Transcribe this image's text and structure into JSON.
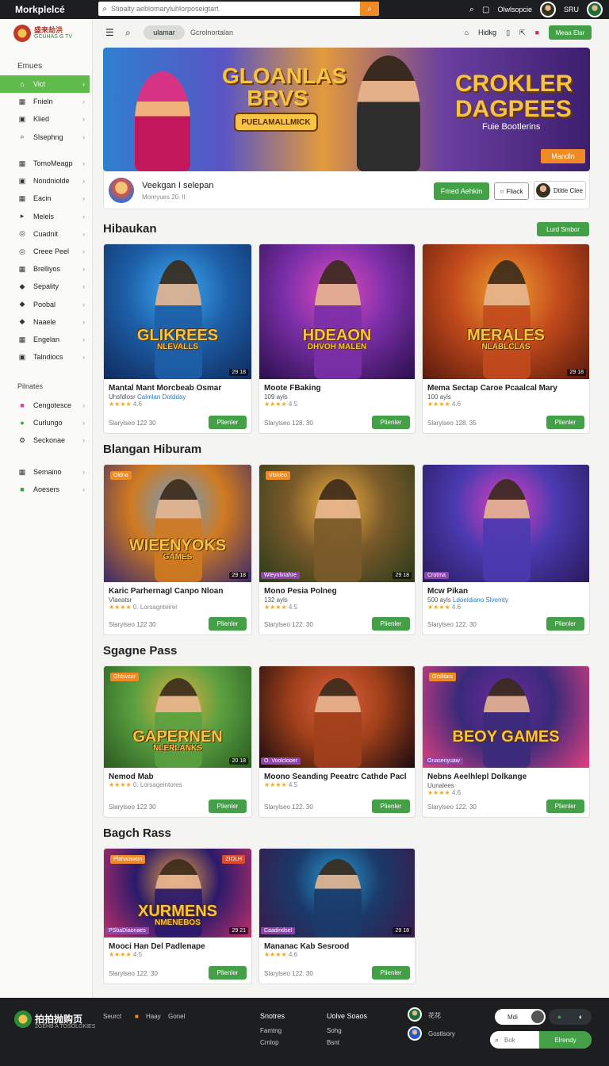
{
  "topbar": {
    "brand": "Morkplelcé",
    "search_placeholder": "Stioalty aeblomaryluhlorposeigtart",
    "search_icon": "search-icon",
    "go_icon": "search-go-icon",
    "right_label": "Olwlsopcie",
    "user_label": "SRU"
  },
  "sidebar": {
    "logo_line1": "盛来劫洪",
    "logo_line2": "GCUHAS G TV",
    "heading1": "Emues",
    "items_group1": [
      {
        "label": "Vict",
        "icon": "home-icon",
        "active": true
      },
      {
        "label": "Fnieln",
        "icon": "grid-icon"
      },
      {
        "label": "Klied",
        "icon": "box-icon"
      },
      {
        "label": "Slsephng",
        "icon": "search-icon"
      }
    ],
    "items_group2": [
      {
        "label": "TomoMeagp",
        "icon": "grid-icon"
      },
      {
        "label": "Nondniolde",
        "icon": "box-icon"
      },
      {
        "label": "Eacin",
        "icon": "grid-icon"
      },
      {
        "label": "Melels",
        "icon": "play-icon"
      },
      {
        "label": "Cuadnit",
        "icon": "circle-icon"
      },
      {
        "label": "Creee Peel",
        "icon": "circle-icon"
      },
      {
        "label": "Brelliyos",
        "icon": "grid-icon"
      },
      {
        "label": "Sepality",
        "icon": "tag-icon"
      },
      {
        "label": "Poobal",
        "icon": "tag-icon"
      },
      {
        "label": "Naaele",
        "icon": "tag-icon"
      },
      {
        "label": "Engelan",
        "icon": "grid-icon"
      },
      {
        "label": "Talndiocs",
        "icon": "box-icon"
      }
    ],
    "heading2": "Pilnates",
    "items_group3": [
      {
        "label": "Cengotesce",
        "icon": "pink-square-icon"
      },
      {
        "label": "Curlungo",
        "icon": "green-circle-icon"
      },
      {
        "label": "Seckonae",
        "icon": "gear-icon"
      }
    ],
    "items_group4": [
      {
        "label": "Semaino",
        "icon": "grid-icon"
      },
      {
        "label": "Aoesers",
        "icon": "green-square-icon"
      }
    ]
  },
  "subnav": {
    "pill_label": "ulamar",
    "text": "Gcrolnortalan",
    "right_text": "Hidkg",
    "button_label": "Meaa Elar"
  },
  "hero": {
    "left_title": "GLOANLAS BRVS",
    "left_sub": "PUELAMALLMICK",
    "right_title": "CROKLER DAGPEES",
    "right_sub": "Fuie Bootlerins",
    "button_label": "Mandln"
  },
  "promo": {
    "title": "Veekgan I selepan",
    "subtitle": "Monryues 20. ll",
    "primary_button": "Fmed Aehkin",
    "outline_button": "Fliack",
    "user_label": "Dtitle Clee"
  },
  "sections": [
    {
      "title": "Hibaukan",
      "button": "Lurd Smbor",
      "cards": [
        {
          "image_text": "GLIKREES",
          "image_sub": "NLEVALLS",
          "badge": "29 18",
          "title": "Mantal Mant Morcbeab Osmar",
          "meta_a": "Uhsfdlosr",
          "meta_link": "Calmlan Dotdday",
          "stars": "★★★★",
          "rating": "4.6",
          "price": "Slarylseo 122 30",
          "button": "Plienler"
        },
        {
          "image_text": "HDEAON",
          "image_sub": "DHVOH MALEN",
          "title": "Moote FBaking",
          "meta_a": "109 ayls",
          "stars": "★★★★",
          "rating": "4.5",
          "price": "Slarylseo 128. 30",
          "button": "Plienler"
        },
        {
          "image_text": "MERALES",
          "image_sub": "NLABLCLAS",
          "badge": "29 18",
          "title": "Mema Sectap Caroe Pcaalcal Mary",
          "meta_a": "100 ayls",
          "stars": "★★★★",
          "rating": "4.6",
          "price": "Slarylseo 128. 35",
          "button": "Plienler"
        }
      ]
    },
    {
      "title": "Blangan Hiburam",
      "cards": [
        {
          "image_text": "WIEENYOKS",
          "image_sub": "GAMES",
          "top_tag": "Oldna",
          "badge": "29 18",
          "title": "Karic Parhernagl Canpo Nloan",
          "meta_a": "Vlaeatsr",
          "stars": "★★★★",
          "rating": "0. Lorsagnteirer",
          "price": "Slarylseo 122 30",
          "button": "Plienler"
        },
        {
          "image_text": "",
          "image_sub": "",
          "top_tag": "Vlshleo",
          "label": "Wleynlvrahre",
          "badge": "29 18",
          "title": "Mono Pesia Polneg",
          "meta_a": "132 ayls",
          "stars": "★★★★",
          "rating": "4.5",
          "price": "Slarylseo 122. 30",
          "button": "Plienler"
        },
        {
          "image_text": "",
          "image_sub": "",
          "label": "Crotma",
          "title": "Mcw Pikan",
          "meta_a": "500 ayls",
          "meta_link": "Ldoeldiano Slvemty",
          "stars": "★★★★",
          "rating": "4.6",
          "price": "Slarylseo 122. 30",
          "button": "Plienler"
        }
      ]
    },
    {
      "title": "Sgagne Pass",
      "cards": [
        {
          "image_text": "GAPERNEN",
          "image_sub": "NLERLANKS",
          "top_tag": "Ohtsvzar",
          "badge": "20 18",
          "title": "Nemod Mab",
          "stars": "★★★★",
          "rating": "0. Lorsageintores",
          "price": "Slarylseo 122 30",
          "button": "Plienler"
        },
        {
          "image_text": "",
          "image_sub": "",
          "label": "O. Voolclooer",
          "title": "Moono Seanding Peeatrc Cathde Pacl",
          "stars": "★★★★",
          "rating": "4.5",
          "price": "Slarylseo 122. 30",
          "button": "Plienler"
        },
        {
          "image_text": "BEOY GAMES",
          "image_sub": "",
          "top_tag": "Orslitars",
          "label": "Onasenyuaw",
          "title": "Nebns Aeelhlepl Dolkange",
          "meta_a": "Uunalees",
          "stars": "★★★★",
          "rating": "4.6",
          "price": "Slarylseo 122. 30",
          "button": "Plienler"
        }
      ]
    },
    {
      "title": "Bagch Rass",
      "cards": [
        {
          "image_text": "XURMENS",
          "image_sub": "NMENEBOS",
          "top_tag": "Plahalawon",
          "top_right": "ZIOLH",
          "label": "PSbaDiaonaes",
          "badge": "29 21",
          "title": "Mooci Han Del Padlenape",
          "stars": "★★★★",
          "rating": "4.5",
          "price": "Slarylseo 122. 30",
          "button": "Plienler"
        },
        {
          "image_text": "",
          "image_sub": "",
          "label": "Caadindsel",
          "badge": "29 18",
          "title": "Mananac Kab Sesrood",
          "stars": "★★★★",
          "rating": "4.6",
          "price": "Slarylseo 122. 30",
          "button": "Plienler"
        }
      ]
    }
  ],
  "footer": {
    "logo_title": "拍拍抛购页",
    "logo_sub": "2GEHB A TOSOLGKIES",
    "link1": "Seurct",
    "link2": "Haay",
    "link3": "Gonel",
    "col1_head": "Snotres",
    "col1_a": "Famtng",
    "col1_b": "Crnlop",
    "col2_head": "Uolve Soaos",
    "col2_a": "Sohg",
    "col2_b": "Bsnt",
    "user1": "花花",
    "user2": "Gostlsory",
    "toggle_label": "Mdi",
    "search_placeholder": "Bok",
    "search_button": "Elrendy"
  }
}
